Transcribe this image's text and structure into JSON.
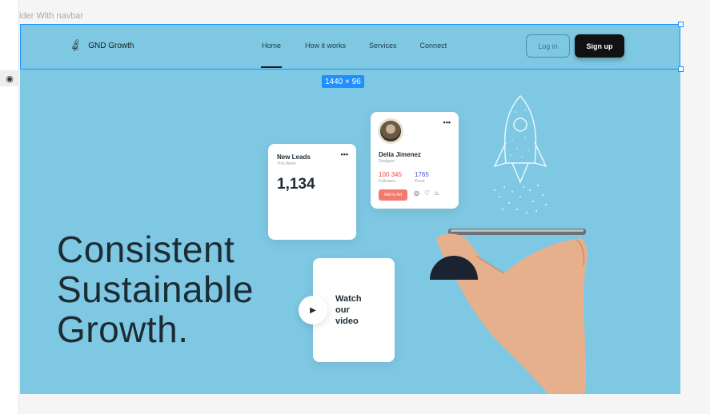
{
  "editor": {
    "frame_label": "ider With navbar",
    "dimension_badge": "1440 × 96",
    "eye_icon": "eye-icon"
  },
  "nav": {
    "brand": "GND Growth",
    "brand_icon": "rocket-icon",
    "links": [
      "Home",
      "How it works",
      "Services",
      "Connect"
    ],
    "active_link": "Home",
    "login_label": "Log in",
    "signup_label": "Sign up"
  },
  "hero": {
    "headline_lines": [
      "Consistent",
      "Sustainable",
      "Growth."
    ],
    "background_color": "#7ec8e3"
  },
  "leads_card": {
    "title": "New Leads",
    "subtitle": "This Week",
    "value": "1,134",
    "more": "•••"
  },
  "profile_card": {
    "name": "Delia Jimenez",
    "role": "Designer",
    "followers_value": "100 345",
    "followers_label": "Followers",
    "posts_value": "1765",
    "posts_label": "Posts",
    "add_button": "Add to list",
    "more": "•••",
    "icons": [
      "comment-icon",
      "heart-icon",
      "bell-icon"
    ]
  },
  "video_card": {
    "lines": [
      "Watch",
      "our",
      "video"
    ],
    "play_icon": "play-icon"
  }
}
